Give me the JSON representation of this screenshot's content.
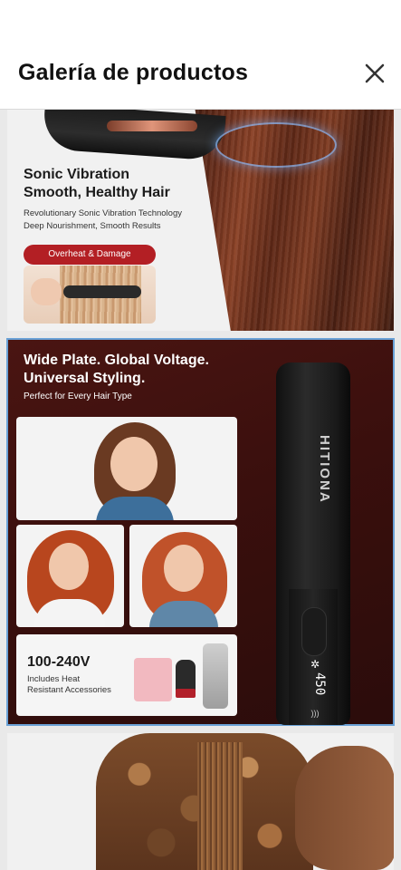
{
  "header": {
    "title": "Galería de productos",
    "close_icon": "close-icon"
  },
  "gallery": {
    "card1": {
      "headline_line1": "Sonic Vibration",
      "headline_line2": "Smooth, Healthy Hair",
      "sub_line1": "Revolutionary Sonic Vibration Technology",
      "sub_line2": "Deep Nourishment, Smooth Results",
      "badge": "Overheat & Damage"
    },
    "card2": {
      "headline_line1": "Wide Plate. Global Voltage.",
      "headline_line2": "Universal Styling.",
      "sub": "Perfect for Every Hair Type",
      "voltage": "100-240V",
      "accessories_line1": "Includes Heat",
      "accessories_line2": "Resistant Accessories",
      "brand": "HITIONA",
      "display_temp": "450",
      "snowflake_icon": "snowflake-icon",
      "signal_icon": "signal-icon",
      "selected_border_color": "#6aa1d6"
    },
    "card3": {}
  }
}
